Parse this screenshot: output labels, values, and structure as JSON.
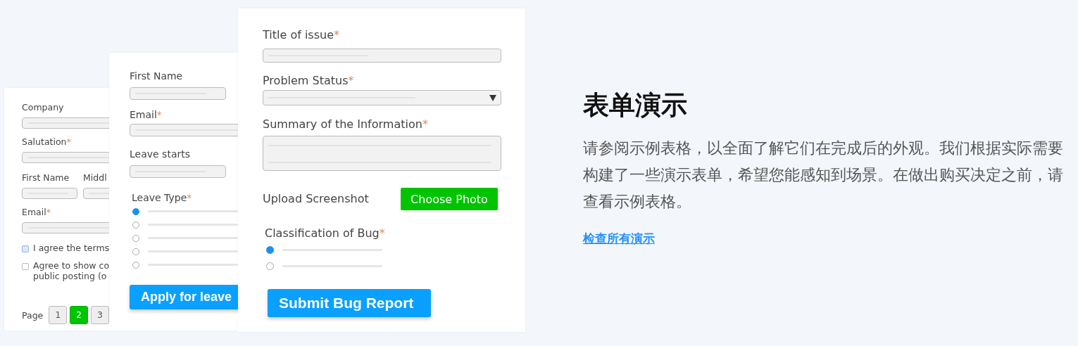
{
  "forms": [
    {
      "items": [
        {
          "kind": "field",
          "label": "Company"
        },
        {
          "kind": "field",
          "label": "Salutation",
          "mark": "*"
        },
        {
          "kind": "pair",
          "labels": [
            "First Name",
            "Middl"
          ]
        },
        {
          "kind": "field",
          "label": "Email",
          "mark": "*"
        },
        {
          "kind": "checkbox",
          "lines": [
            "I agree the terms"
          ],
          "checked": true
        },
        {
          "kind": "checkbox",
          "lines": [
            "Agree to show co",
            "public posting (o"
          ],
          "checked": false
        },
        {
          "kind": "pager",
          "label": "Page",
          "pages": [
            {
              "label": "1",
              "selected": false
            },
            {
              "label": "2",
              "selected": true
            },
            {
              "label": "3",
              "selected": false
            }
          ]
        }
      ]
    },
    {
      "items": [
        {
          "kind": "field",
          "label": "First Name"
        },
        {
          "kind": "field",
          "label": "Email",
          "mark": "*",
          "wide": true
        },
        {
          "kind": "field",
          "label": "Leave starts"
        },
        {
          "kind": "radios",
          "label": "Leave Type",
          "mark": "*",
          "options": [
            {
              "selected": true
            },
            {
              "selected": false
            },
            {
              "selected": false
            },
            {
              "selected": false
            },
            {
              "selected": false
            }
          ]
        },
        {
          "kind": "submit",
          "label": "Apply for leave"
        }
      ]
    },
    {
      "items": [
        {
          "kind": "field",
          "label": "Title of issue",
          "mark": "*"
        },
        {
          "kind": "select",
          "label": "Problem Status",
          "mark": "*"
        },
        {
          "kind": "textarea",
          "label": "Summary of the Information",
          "mark": "*"
        },
        {
          "kind": "upload",
          "label": "Upload Screenshot",
          "button": "Choose Photo"
        },
        {
          "kind": "radios",
          "label": "Classification of Bug",
          "mark": "*",
          "options": [
            {
              "selected": true
            },
            {
              "selected": false
            }
          ]
        },
        {
          "kind": "submit",
          "label": "Submit Bug Report"
        }
      ]
    }
  ],
  "section": {
    "title": "表单演示",
    "description": "请参阅示例表格，以全面了解它们在完成后的外观。我们根据实际需要构建了一些演示表单，希望您能感知到场景。在做出购买决定之前，请查看示例表格。",
    "link": "检查所有演示"
  }
}
